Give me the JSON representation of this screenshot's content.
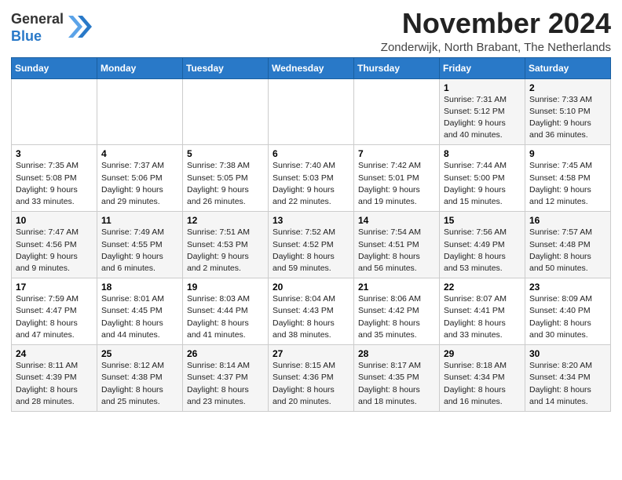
{
  "logo": {
    "general": "General",
    "blue": "Blue"
  },
  "title": "November 2024",
  "subtitle": "Zonderwijk, North Brabant, The Netherlands",
  "weekdays": [
    "Sunday",
    "Monday",
    "Tuesday",
    "Wednesday",
    "Thursday",
    "Friday",
    "Saturday"
  ],
  "weeks": [
    [
      {
        "day": "",
        "info": ""
      },
      {
        "day": "",
        "info": ""
      },
      {
        "day": "",
        "info": ""
      },
      {
        "day": "",
        "info": ""
      },
      {
        "day": "",
        "info": ""
      },
      {
        "day": "1",
        "info": "Sunrise: 7:31 AM\nSunset: 5:12 PM\nDaylight: 9 hours\nand 40 minutes."
      },
      {
        "day": "2",
        "info": "Sunrise: 7:33 AM\nSunset: 5:10 PM\nDaylight: 9 hours\nand 36 minutes."
      }
    ],
    [
      {
        "day": "3",
        "info": "Sunrise: 7:35 AM\nSunset: 5:08 PM\nDaylight: 9 hours\nand 33 minutes."
      },
      {
        "day": "4",
        "info": "Sunrise: 7:37 AM\nSunset: 5:06 PM\nDaylight: 9 hours\nand 29 minutes."
      },
      {
        "day": "5",
        "info": "Sunrise: 7:38 AM\nSunset: 5:05 PM\nDaylight: 9 hours\nand 26 minutes."
      },
      {
        "day": "6",
        "info": "Sunrise: 7:40 AM\nSunset: 5:03 PM\nDaylight: 9 hours\nand 22 minutes."
      },
      {
        "day": "7",
        "info": "Sunrise: 7:42 AM\nSunset: 5:01 PM\nDaylight: 9 hours\nand 19 minutes."
      },
      {
        "day": "8",
        "info": "Sunrise: 7:44 AM\nSunset: 5:00 PM\nDaylight: 9 hours\nand 15 minutes."
      },
      {
        "day": "9",
        "info": "Sunrise: 7:45 AM\nSunset: 4:58 PM\nDaylight: 9 hours\nand 12 minutes."
      }
    ],
    [
      {
        "day": "10",
        "info": "Sunrise: 7:47 AM\nSunset: 4:56 PM\nDaylight: 9 hours\nand 9 minutes."
      },
      {
        "day": "11",
        "info": "Sunrise: 7:49 AM\nSunset: 4:55 PM\nDaylight: 9 hours\nand 6 minutes."
      },
      {
        "day": "12",
        "info": "Sunrise: 7:51 AM\nSunset: 4:53 PM\nDaylight: 9 hours\nand 2 minutes."
      },
      {
        "day": "13",
        "info": "Sunrise: 7:52 AM\nSunset: 4:52 PM\nDaylight: 8 hours\nand 59 minutes."
      },
      {
        "day": "14",
        "info": "Sunrise: 7:54 AM\nSunset: 4:51 PM\nDaylight: 8 hours\nand 56 minutes."
      },
      {
        "day": "15",
        "info": "Sunrise: 7:56 AM\nSunset: 4:49 PM\nDaylight: 8 hours\nand 53 minutes."
      },
      {
        "day": "16",
        "info": "Sunrise: 7:57 AM\nSunset: 4:48 PM\nDaylight: 8 hours\nand 50 minutes."
      }
    ],
    [
      {
        "day": "17",
        "info": "Sunrise: 7:59 AM\nSunset: 4:47 PM\nDaylight: 8 hours\nand 47 minutes."
      },
      {
        "day": "18",
        "info": "Sunrise: 8:01 AM\nSunset: 4:45 PM\nDaylight: 8 hours\nand 44 minutes."
      },
      {
        "day": "19",
        "info": "Sunrise: 8:03 AM\nSunset: 4:44 PM\nDaylight: 8 hours\nand 41 minutes."
      },
      {
        "day": "20",
        "info": "Sunrise: 8:04 AM\nSunset: 4:43 PM\nDaylight: 8 hours\nand 38 minutes."
      },
      {
        "day": "21",
        "info": "Sunrise: 8:06 AM\nSunset: 4:42 PM\nDaylight: 8 hours\nand 35 minutes."
      },
      {
        "day": "22",
        "info": "Sunrise: 8:07 AM\nSunset: 4:41 PM\nDaylight: 8 hours\nand 33 minutes."
      },
      {
        "day": "23",
        "info": "Sunrise: 8:09 AM\nSunset: 4:40 PM\nDaylight: 8 hours\nand 30 minutes."
      }
    ],
    [
      {
        "day": "24",
        "info": "Sunrise: 8:11 AM\nSunset: 4:39 PM\nDaylight: 8 hours\nand 28 minutes."
      },
      {
        "day": "25",
        "info": "Sunrise: 8:12 AM\nSunset: 4:38 PM\nDaylight: 8 hours\nand 25 minutes."
      },
      {
        "day": "26",
        "info": "Sunrise: 8:14 AM\nSunset: 4:37 PM\nDaylight: 8 hours\nand 23 minutes."
      },
      {
        "day": "27",
        "info": "Sunrise: 8:15 AM\nSunset: 4:36 PM\nDaylight: 8 hours\nand 20 minutes."
      },
      {
        "day": "28",
        "info": "Sunrise: 8:17 AM\nSunset: 4:35 PM\nDaylight: 8 hours\nand 18 minutes."
      },
      {
        "day": "29",
        "info": "Sunrise: 8:18 AM\nSunset: 4:34 PM\nDaylight: 8 hours\nand 16 minutes."
      },
      {
        "day": "30",
        "info": "Sunrise: 8:20 AM\nSunset: 4:34 PM\nDaylight: 8 hours\nand 14 minutes."
      }
    ]
  ]
}
